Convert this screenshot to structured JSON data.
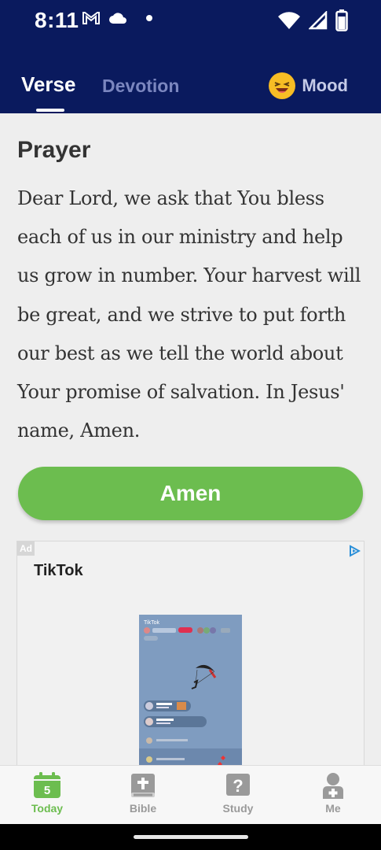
{
  "status": {
    "time": "8:11"
  },
  "tabs": [
    {
      "label": "Verse",
      "active": true
    },
    {
      "label": "Devotion",
      "active": false
    }
  ],
  "mood": {
    "label": "Mood",
    "icon": "laughing-emoji-icon"
  },
  "prayer": {
    "heading": "Prayer",
    "text": "Dear Lord, we ask that You bless each of us in our ministry and help us grow in number. Your harvest will be great, and we strive to put forth our best as we tell the world about Your promise of salvation. In Jesus' name, Amen."
  },
  "amen_button": {
    "label": "Amen",
    "color": "#6cbd4f"
  },
  "ad": {
    "badge": "Ad",
    "advertiser": "TikTok",
    "preview_brand": "TikTok"
  },
  "bottom_nav": {
    "items": [
      {
        "label": "Today",
        "icon": "calendar-icon",
        "badge": "5",
        "active": true
      },
      {
        "label": "Bible",
        "icon": "book-icon",
        "active": false
      },
      {
        "label": "Study",
        "icon": "question-icon",
        "active": false
      },
      {
        "label": "Me",
        "icon": "person-icon",
        "active": false
      }
    ]
  },
  "colors": {
    "header": "#0a1a5e",
    "accent": "#6cbd4f",
    "background": "#eeeeee"
  }
}
